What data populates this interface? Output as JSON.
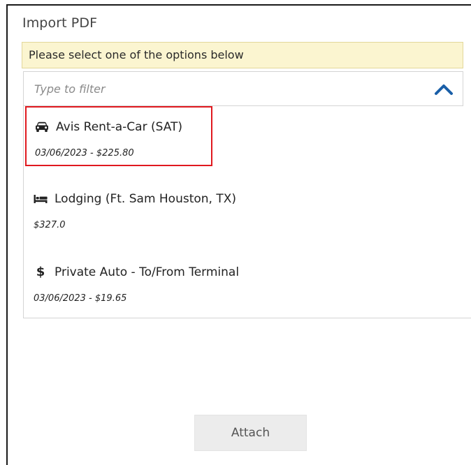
{
  "dialog": {
    "title": "Import PDF",
    "notice": "Please select one of the options below"
  },
  "filter": {
    "placeholder": "Type to filter",
    "value": "",
    "toggle_icon": "chevron-up-icon",
    "accent_color": "#1a5fa8"
  },
  "options": [
    {
      "icon": "car-icon",
      "label": "Avis Rent-a-Car (SAT)",
      "detail": "03/06/2023 - $225.80",
      "selected": true
    },
    {
      "icon": "bed-icon",
      "label": "Lodging (Ft. Sam Houston, TX)",
      "detail": "$327.0",
      "selected": false
    },
    {
      "icon": "dollar-icon",
      "label": "Private Auto - To/From Terminal",
      "detail": "03/06/2023 - $19.65",
      "selected": false
    }
  ],
  "highlight_color": "#e0191f",
  "actions": {
    "attach_label": "Attach"
  }
}
